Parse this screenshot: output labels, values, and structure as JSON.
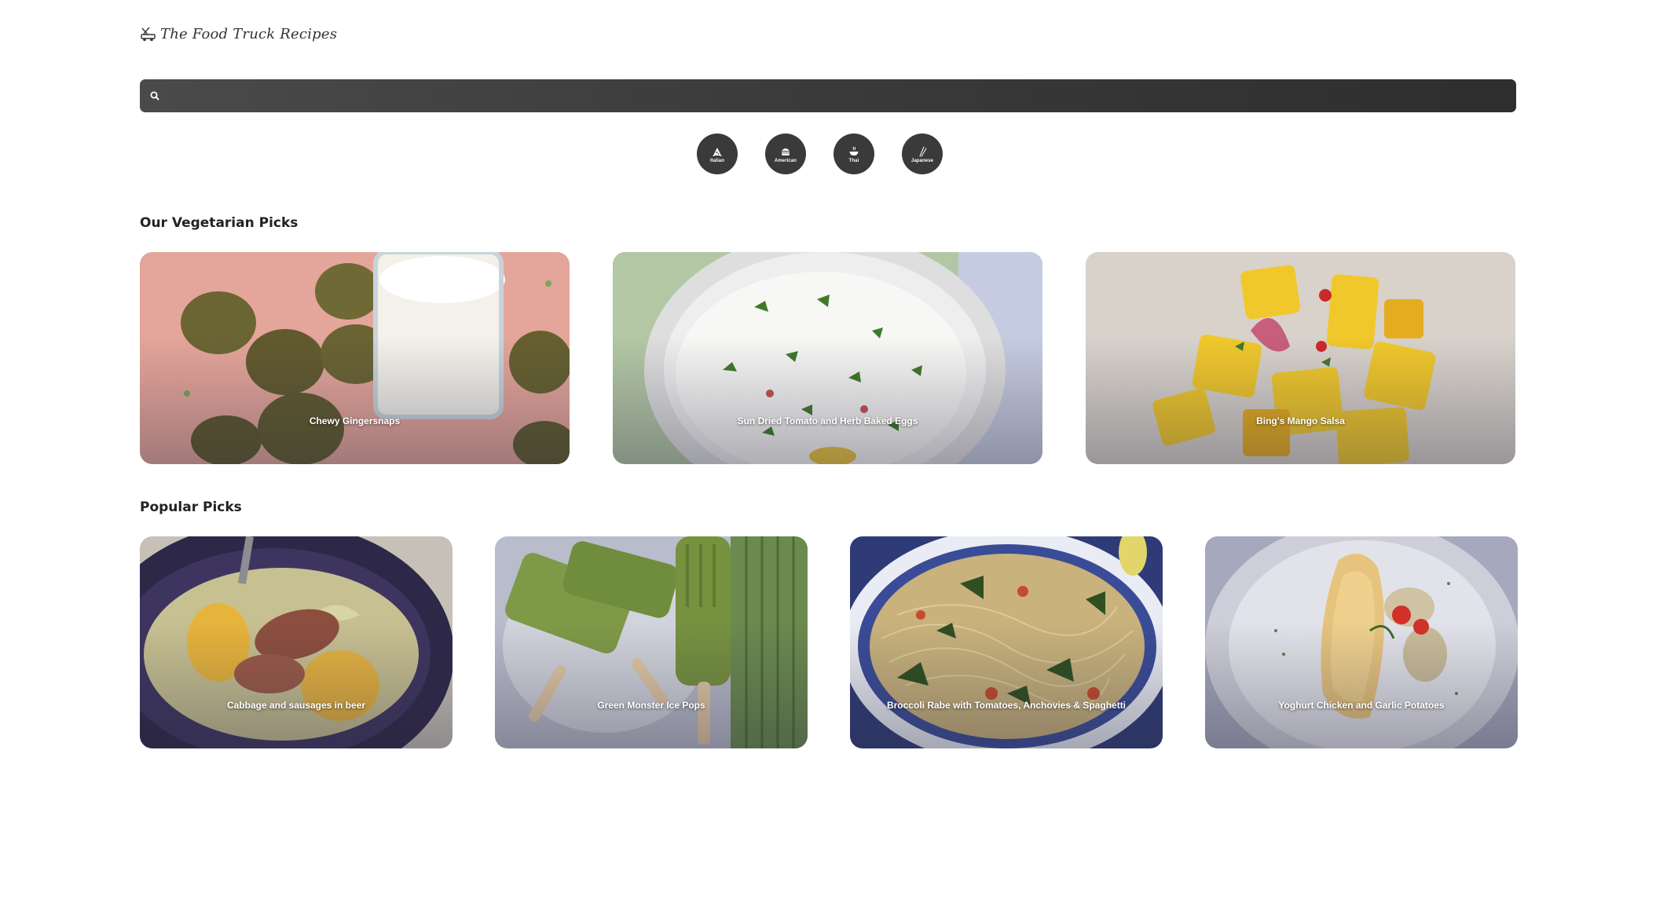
{
  "logo": {
    "text": "The Food Truck Recipes",
    "icon": "food-truck-icon"
  },
  "search": {
    "placeholder": "",
    "value": "",
    "icon": "search-icon"
  },
  "categories": [
    {
      "label": "Italian",
      "icon": "pizza-icon"
    },
    {
      "label": "American",
      "icon": "burger-icon"
    },
    {
      "label": "Thai",
      "icon": "bowl-icon"
    },
    {
      "label": "Japanese",
      "icon": "chopsticks-icon"
    }
  ],
  "vegetarian": {
    "title": "Our Vegetarian Picks",
    "items": [
      {
        "title": "Chewy Gingersnaps"
      },
      {
        "title": "Sun Dried Tomato and Herb Baked Eggs"
      },
      {
        "title": "Bing's Mango Salsa"
      }
    ]
  },
  "popular": {
    "title": "Popular Picks",
    "items": [
      {
        "title": "Cabbage and sausages in beer"
      },
      {
        "title": "Green Monster Ice Pops"
      },
      {
        "title": "Broccoli Rabe with Tomatoes, Anchovies & Spaghetti"
      },
      {
        "title": "Yoghurt Chicken and Garlic Potatoes"
      }
    ]
  },
  "colors": {
    "search_bg": "#3a3a3a",
    "category_bg": "#3a3a3a",
    "text": "#222222"
  }
}
